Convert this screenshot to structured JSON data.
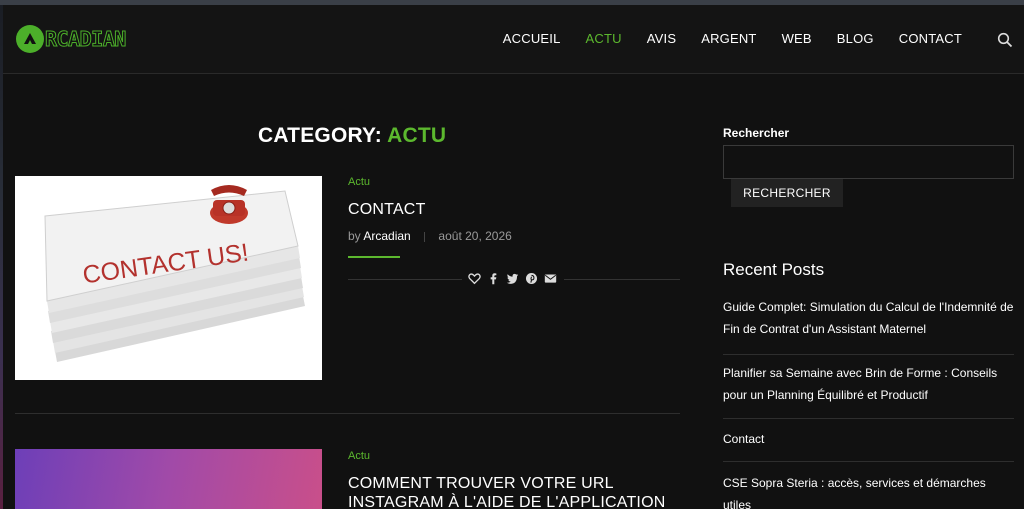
{
  "brand": {
    "name": "RCADIAN",
    "accent": "#5cb82e",
    "logo_icon": "arcadian-logo-icon"
  },
  "nav": {
    "items": [
      {
        "label": "ACCUEIL",
        "active": false
      },
      {
        "label": "ACTU",
        "active": true
      },
      {
        "label": "AVIS",
        "active": false
      },
      {
        "label": "ARGENT",
        "active": false
      },
      {
        "label": "WEB",
        "active": false
      },
      {
        "label": "BLOG",
        "active": false
      },
      {
        "label": "CONTACT",
        "active": false
      }
    ],
    "search_icon": "search-icon"
  },
  "page": {
    "title_prefix": "CATEGORY:",
    "title_category": "ACTU"
  },
  "posts": [
    {
      "category": "Actu",
      "title": "CONTACT",
      "by": "by",
      "author": "Arcadian",
      "date": "août 20, 2026",
      "thumb_text": "CONTACT US!",
      "share_icons": [
        "heart-icon",
        "facebook-icon",
        "twitter-icon",
        "pinterest-icon",
        "email-icon"
      ]
    },
    {
      "category": "Actu",
      "title": "COMMENT TROUVER VOTRE URL INSTAGRAM À L'AIDE DE L'APPLICATION"
    }
  ],
  "sidebar": {
    "search_label": "Rechercher",
    "search_placeholder": "",
    "search_button": "RECHERCHER",
    "recent_title": "Recent Posts",
    "recent": [
      "Guide Complet: Simulation du Calcul de l'Indemnité de Fin de Contrat d'un Assistant Maternel",
      "Planifier sa Semaine avec Brin de Forme : Conseils pour un Planning Équilibré et Productif",
      "Contact",
      "CSE Sopra Steria : accès, services et démarches utiles"
    ]
  }
}
